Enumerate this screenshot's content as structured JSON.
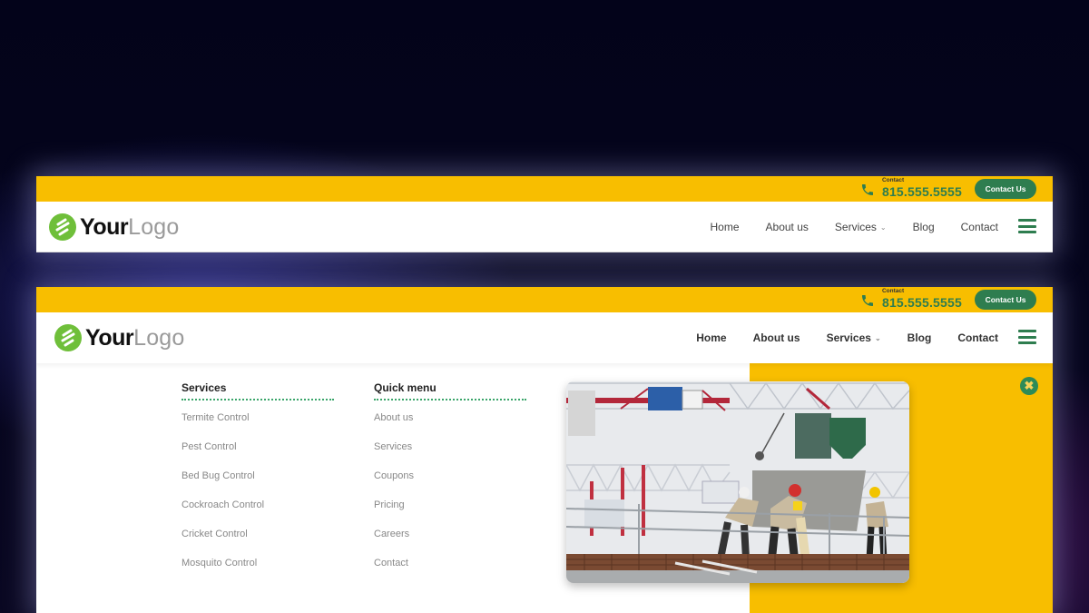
{
  "header_compact": {
    "logo": {
      "bold": "Your",
      "light": "Logo"
    },
    "contact_label": "Contact",
    "phone": "815.555.5555",
    "contact_button": "Contact Us",
    "nav": [
      {
        "label": "Home"
      },
      {
        "label": "About us"
      },
      {
        "label": "Services",
        "has_dropdown": true,
        "caret": "⌄"
      },
      {
        "label": "Blog"
      },
      {
        "label": "Contact"
      }
    ],
    "menu_icon": "hamburger-icon"
  },
  "header_expanded": {
    "logo": {
      "bold": "Your",
      "light": "Logo"
    },
    "contact_label": "Contact",
    "phone": "815.555.5555",
    "contact_button": "Contact Us",
    "nav": [
      {
        "label": "Home"
      },
      {
        "label": "About us"
      },
      {
        "label": "Services",
        "has_dropdown": true,
        "caret": "⌄"
      },
      {
        "label": "Blog"
      },
      {
        "label": "Contact"
      }
    ],
    "menu_icon": "hamburger-icon"
  },
  "mega_menu": {
    "services": {
      "title": "Services",
      "items": [
        "Termite Control",
        "Pest Control",
        "Bed Bug Control",
        "Cockroach Control",
        "Cricket Control",
        "Mosquito Control"
      ]
    },
    "quick_menu": {
      "title": "Quick menu",
      "items": [
        "About us",
        "Services",
        "Coupons",
        "Pricing",
        "Careers",
        "Contact"
      ]
    },
    "image": {
      "alt": "Construction workers pouring concrete on a building site with cranes"
    },
    "close_icon": "✖"
  },
  "colors": {
    "brand_yellow": "#f8be00",
    "brand_green": "#2e7d4f",
    "logo_green": "#6fbf3a"
  }
}
